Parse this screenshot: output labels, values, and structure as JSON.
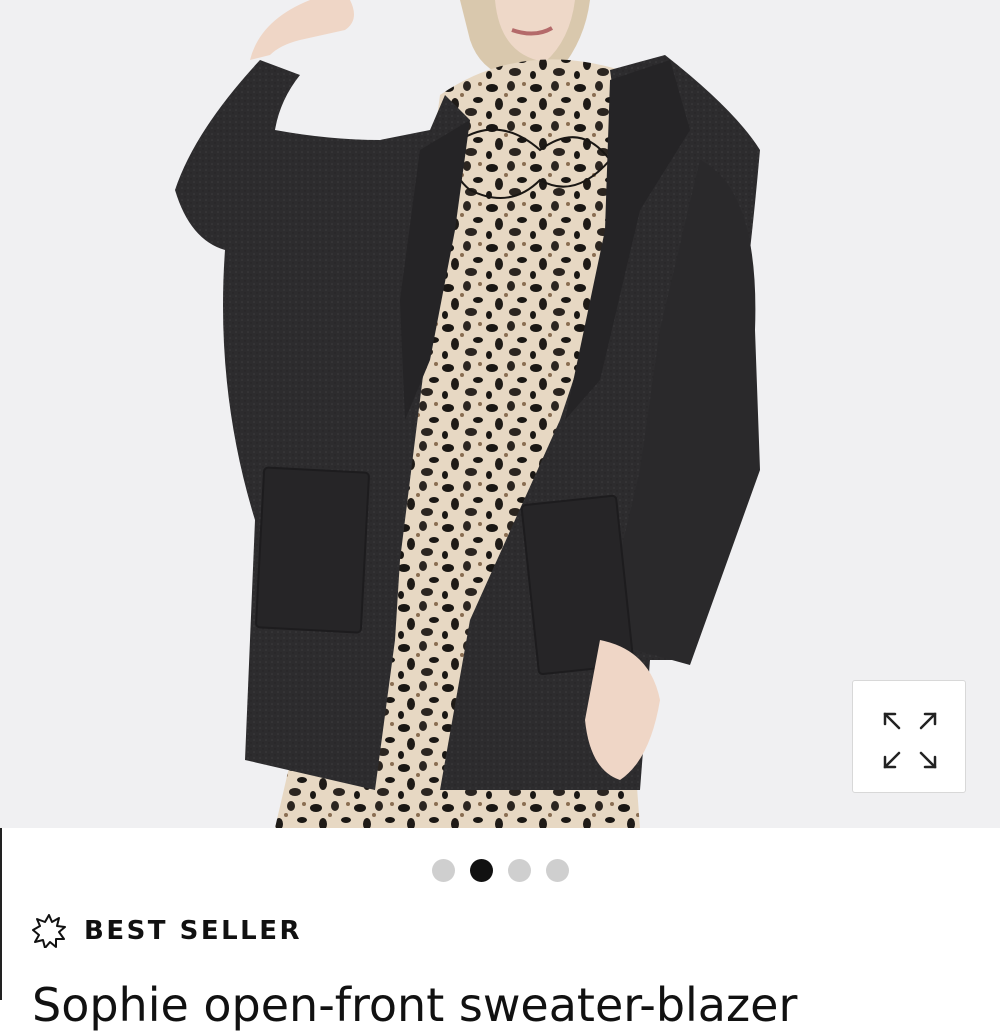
{
  "gallery": {
    "image_alt": "Model wearing dark charcoal open-front sweater-blazer over leopard print tie-neck blouse and skirt",
    "expand_icon": "expand-arrows-icon"
  },
  "carousel": {
    "slide_count": 4,
    "active_index": 1
  },
  "badge": {
    "icon": "starburst-icon",
    "label": "BEST SELLER"
  },
  "product": {
    "title": "Sophie open-front sweater-blazer"
  }
}
